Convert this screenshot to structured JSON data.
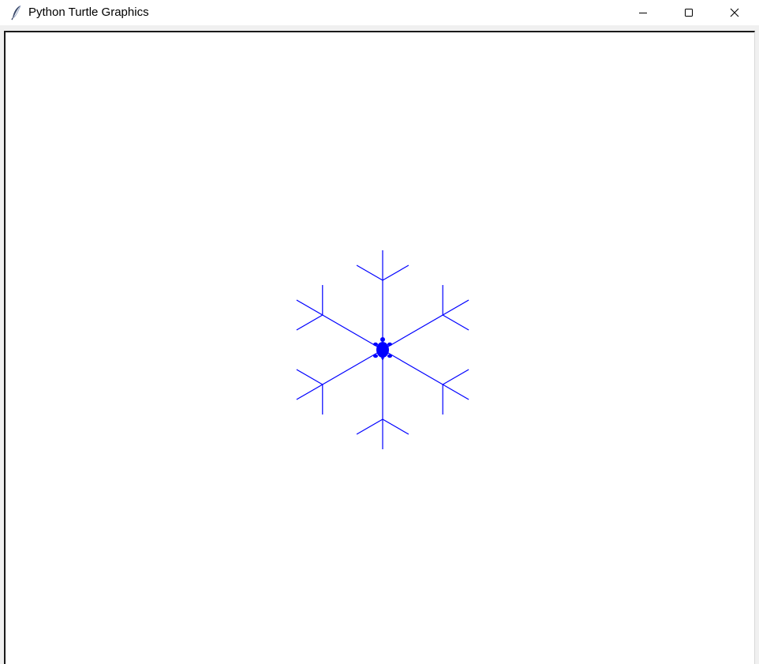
{
  "window": {
    "title": "Python Turtle Graphics",
    "app_icon": "feather-icon"
  },
  "controls": {
    "minimize_icon": "minimize-icon",
    "maximize_icon": "maximize-icon",
    "close_icon": "close-icon"
  },
  "canvas": {
    "background": "#ffffff",
    "pen_color": "#0000ff",
    "turtle_color": "#0000ff",
    "turtle_heading_deg": 90,
    "drawing": {
      "shape": "snowflake",
      "arms": 6,
      "branches_per_arm": 2
    }
  }
}
